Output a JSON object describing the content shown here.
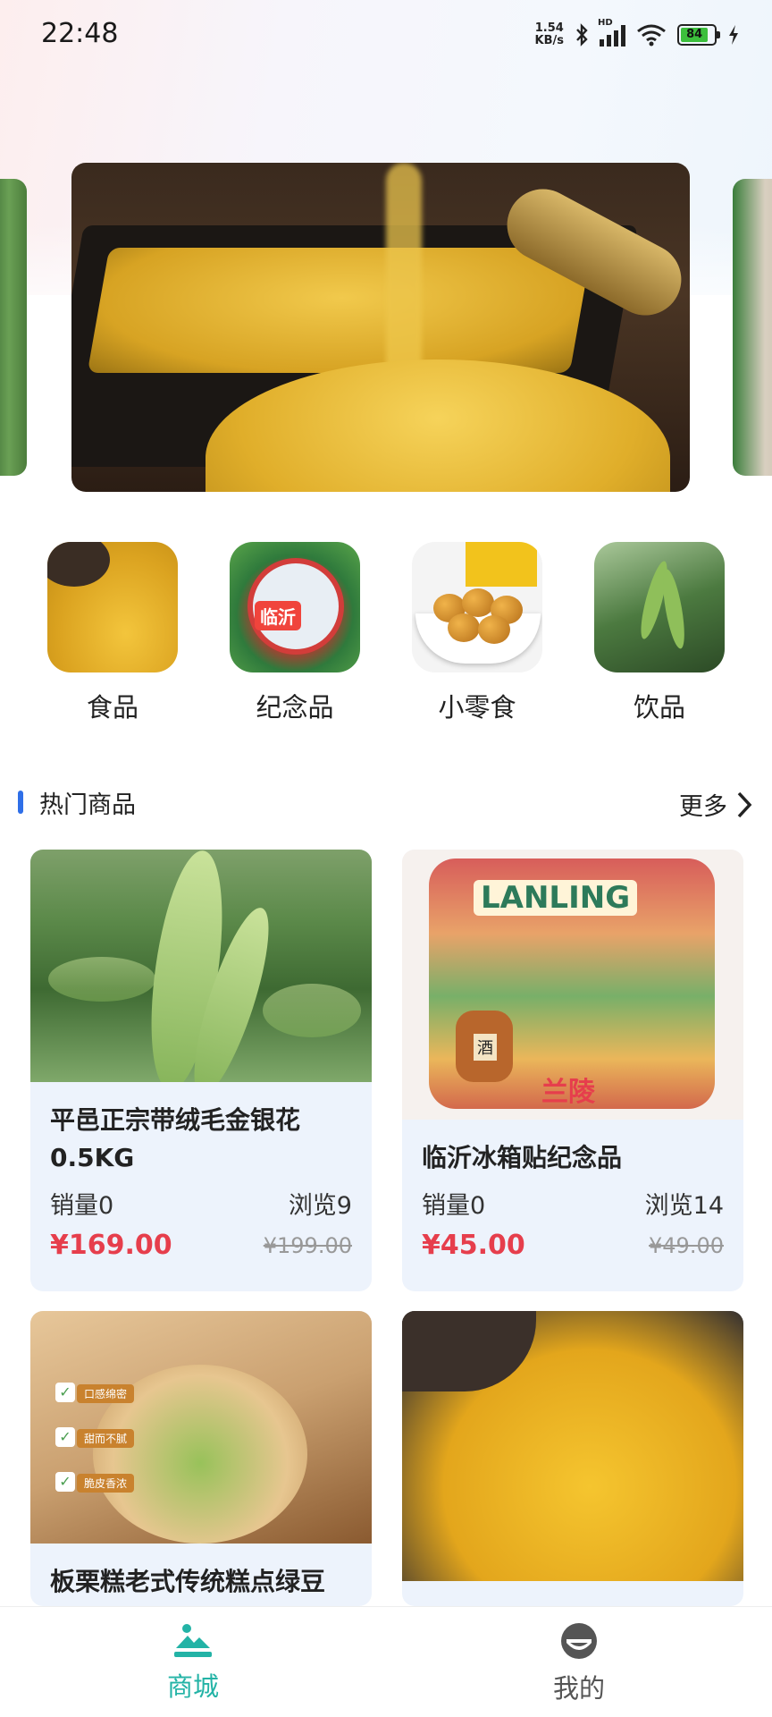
{
  "status_bar": {
    "time": "22:48",
    "net_speed_value": "1.54",
    "net_speed_unit": "KB/s",
    "network_type": "HD",
    "battery_level": "84",
    "icons": [
      "bluetooth-icon",
      "signal-icon",
      "wifi-icon",
      "battery-icon",
      "charging-icon"
    ]
  },
  "banner": {
    "items": [
      "leaf-banner",
      "millet-banner",
      "tea-banner"
    ],
    "active_index": 1
  },
  "categories": [
    {
      "label": "食品"
    },
    {
      "label": "纪念品",
      "image_text": "临沂"
    },
    {
      "label": "小零食"
    },
    {
      "label": "饮品"
    }
  ],
  "hot_section": {
    "title": "热门商品",
    "more_label": "更多"
  },
  "products": [
    {
      "name": "平邑正宗带绒毛金银花0.5KG",
      "sales": "销量0",
      "views": "浏览9",
      "price": "¥169.00",
      "original_price": "¥199.00"
    },
    {
      "name": "临沂冰箱贴纪念品",
      "sales": "销量0",
      "views": "浏览14",
      "price": "¥45.00",
      "original_price": "¥49.00",
      "image_text": "LANLING",
      "image_text2": "兰陵",
      "image_text3": "酒"
    },
    {
      "name": "板栗糕老式传统糕点绿豆",
      "tags": [
        "口感绵密",
        "甜而不腻",
        "脆皮香浓"
      ]
    },
    {
      "name": ""
    }
  ],
  "tabbar": {
    "items": [
      {
        "label": "商城",
        "icon": "mall-icon",
        "active": true
      },
      {
        "label": "我的",
        "icon": "profile-icon",
        "active": false
      }
    ]
  },
  "colors": {
    "accent": "#23b3a6",
    "price": "#e63e4c",
    "section_bar": "#2f6fe8",
    "card_bg": "#edf3fc"
  }
}
